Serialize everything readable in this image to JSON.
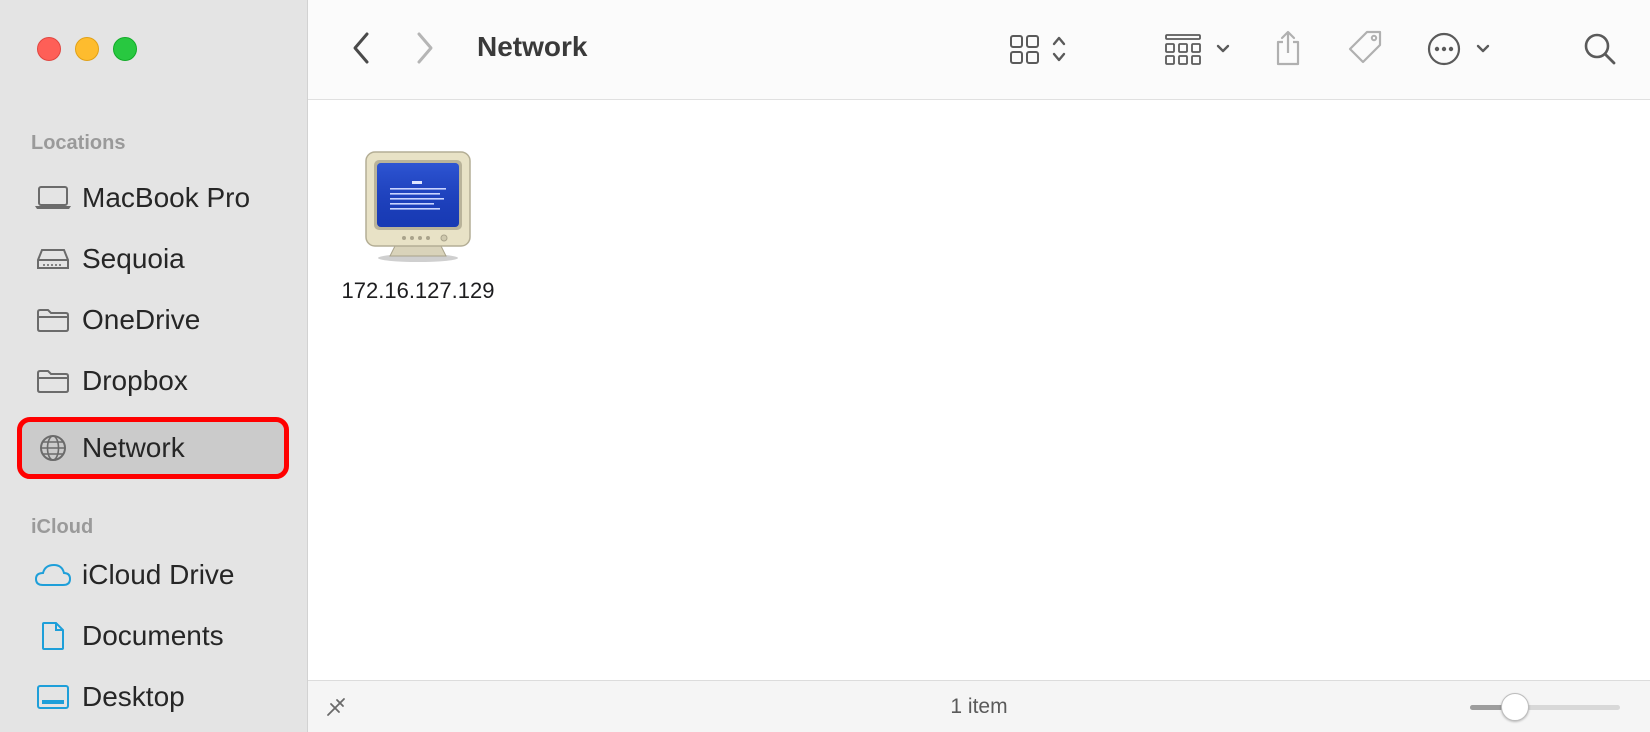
{
  "window": {
    "title": "Network",
    "traffic_lights": [
      "close",
      "minimize",
      "zoom"
    ]
  },
  "sidebar": {
    "sections": [
      {
        "label": "Locations",
        "items": [
          {
            "label": "MacBook Pro",
            "icon": "laptop-icon"
          },
          {
            "label": "Sequoia",
            "icon": "drive-icon"
          },
          {
            "label": "OneDrive",
            "icon": "folder-icon"
          },
          {
            "label": "Dropbox",
            "icon": "folder-icon"
          },
          {
            "label": "Network",
            "icon": "globe-icon",
            "selected": true
          }
        ]
      },
      {
        "label": "iCloud",
        "items": [
          {
            "label": "iCloud Drive",
            "icon": "cloud-icon"
          },
          {
            "label": "Documents",
            "icon": "document-icon"
          },
          {
            "label": "Desktop",
            "icon": "desktop-icon"
          }
        ]
      }
    ]
  },
  "toolbar": {
    "title": "Network",
    "buttons": [
      "back",
      "forward",
      "view-mode",
      "group-by",
      "share",
      "tags",
      "more-actions",
      "search"
    ]
  },
  "content": {
    "items": [
      {
        "name": "172.16.127.129",
        "icon": "computer-monitor-icon"
      }
    ]
  },
  "statusbar": {
    "item_count": "1 item",
    "icon_size": 0.25
  },
  "colors": {
    "selection_highlight": "#ff0000",
    "sidebar_bg": "#e4e4e4",
    "icloud_icon": "#1e9fd9",
    "close": "#fe5f57",
    "minimize": "#febc2e",
    "zoom": "#28c840"
  }
}
